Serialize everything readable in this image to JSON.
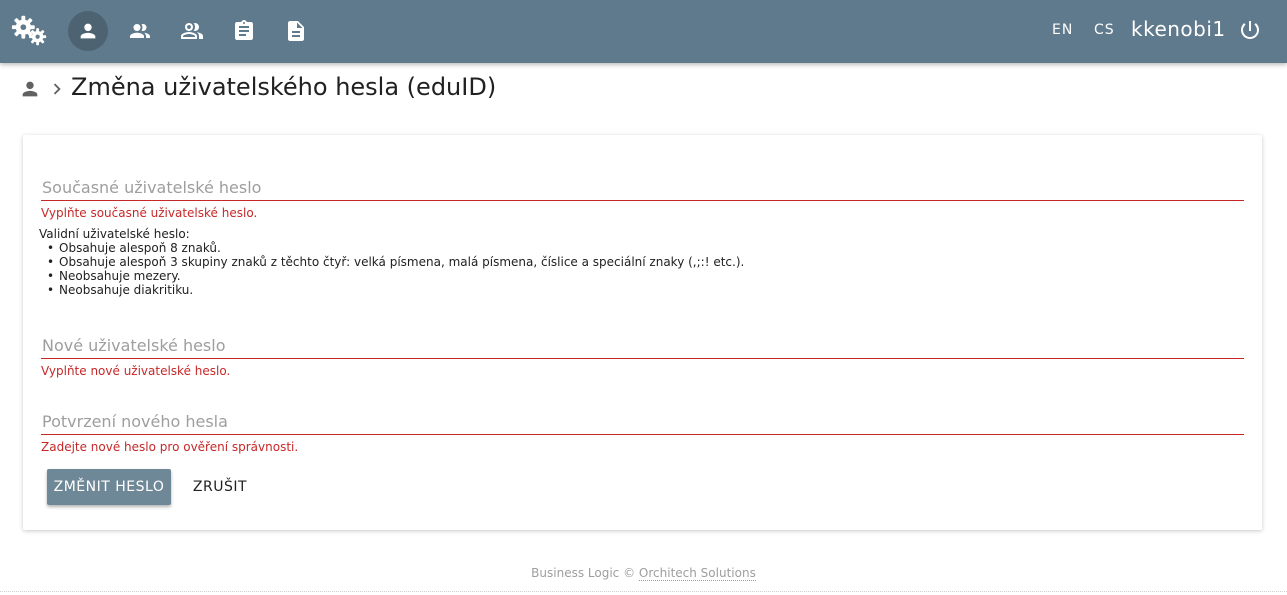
{
  "header": {
    "nav_icons": [
      "settings-gears-icon",
      "person-icon",
      "supervisor-icon",
      "group-icon",
      "clipboard-icon",
      "document-icon"
    ],
    "active_nav": "person-icon",
    "languages": [
      "EN",
      "CS"
    ],
    "username": "kkenobi1",
    "logout_icon": "power-icon",
    "colors": {
      "bar": "#5f7a8c",
      "active": "#4e6372"
    }
  },
  "breadcrumb": {
    "title": "Změna uživatelského hesla (eduID)"
  },
  "form": {
    "current_password": {
      "placeholder": "Současné uživatelské heslo",
      "value": "",
      "error": "Vyplňte současné uživatelské heslo."
    },
    "rules": {
      "heading": "Validní uživatelské heslo:",
      "items": [
        "Obsahuje alespoň 8 znaků.",
        "Obsahuje alespoň 3 skupiny znaků z těchto čtyř: velká písmena, malá písmena, číslice a speciální znaky (,;:! etc.).",
        "Neobsahuje mezery.",
        "Neobsahuje diakritiku."
      ]
    },
    "new_password": {
      "placeholder": "Nové uživatelské heslo",
      "value": "",
      "error": "Vyplňte nové uživatelské heslo."
    },
    "confirm_password": {
      "placeholder": "Potvrzení nového hesla",
      "value": "",
      "error": "Zadejte nové heslo pro ověření správnosti."
    },
    "submit_label": "ZMĚNIT HESLO",
    "cancel_label": "ZRUŠIT",
    "error_color": "#c62828"
  },
  "footer": {
    "text": "Business Logic ©",
    "link": "Orchitech Solutions"
  }
}
